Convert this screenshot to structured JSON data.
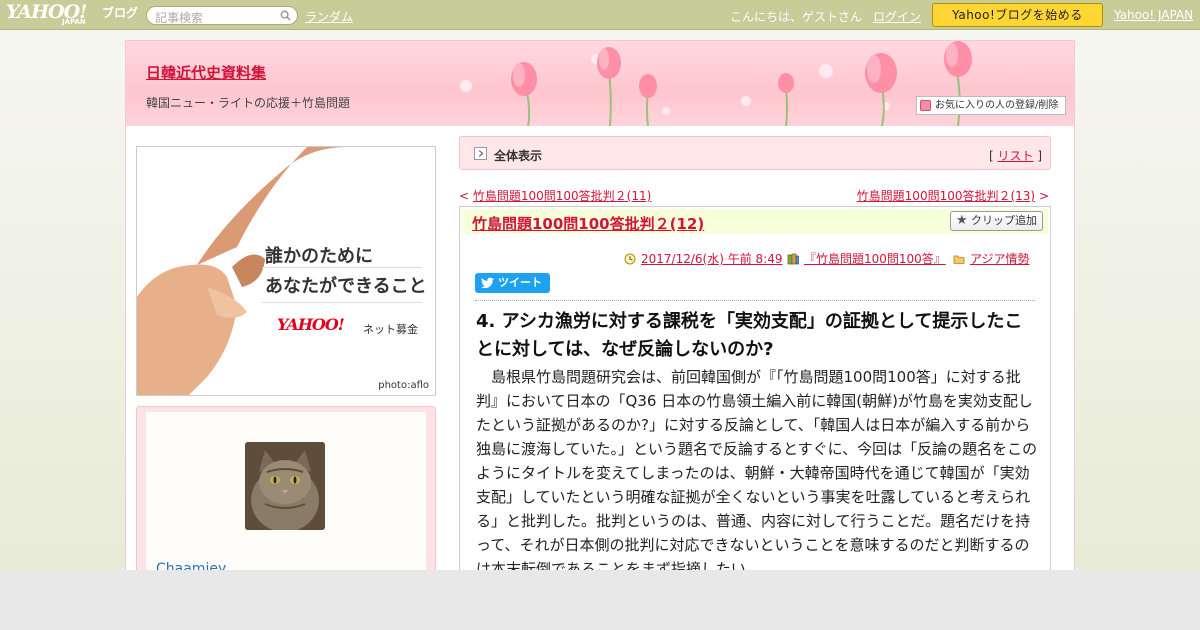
{
  "topbar": {
    "logo_text": "YAHOO!",
    "logo_sub": "JAPAN",
    "logo_blog": "ブログ",
    "search_placeholder": "記事検索",
    "random_label": "ランダム",
    "greeting": "こんにちは、ゲストさん",
    "login_label": "ログイン",
    "start_button": "Yahoo!ブログを始める",
    "yahoo_japan_link": "Yahoo! JAPAN"
  },
  "header": {
    "blog_title": "日韓近代史資料集",
    "blog_description": "韓国ニュー・ライトの応援＋竹島問題",
    "favorite_button": "お気に入りの人の登録/削除"
  },
  "sidebar": {
    "banner": {
      "line1": "誰かのために",
      "line2": "あなたができること",
      "brand": "YAHOO!",
      "brand_sub": "ネット募金",
      "credit": "photo:aflo"
    },
    "profile": {
      "name": "Chaamiey"
    }
  },
  "main": {
    "full_view_label": "全体表示",
    "list_bracket_open": "[ ",
    "list_link": "リスト",
    "list_bracket_close": " ]",
    "prev_arrow": "< ",
    "prev_link": "竹島問題100問100答批判２(11)",
    "next_link": "竹島問題100問100答批判２(13)",
    "next_arrow": " >",
    "article": {
      "title": "竹島問題100問100答批判２(12)",
      "clip_button": "クリップ追加",
      "date": "2017/12/6(水) 午前 8:49",
      "book": "『竹島問題100問100答』",
      "category": "アジア情勢",
      "tweet_label": "ツイート",
      "heading": "4. アシカ漁労に対する課税を「実効支配」の証拠として提示したことに対しては、なぜ反論しないのか?",
      "body": "島根県竹島問題研究会は、前回韓国側が『「竹島問題100問100答」に対する批判』において日本の「Q36 日本の竹島領土編入前に韓国(朝鮮)が竹島を実効支配したという証拠があるのか?」に対する反論として、「韓国人は日本が編入する前から独島に渡海していた。」という題名で反論するとすぐに、今回は「反論の題名をこのようにタイトルを変えてしまったのは、朝鮮・大韓帝国時代を通じて韓国が「実効支配」していたという明確な証拠が全くないという事実を吐露していると考えられる」と批判した。批判というのは、普通、内容に対して行うことだ。題名だけを持って、それが日本側の批判に対応できないということを意味するのだと判断するのは本末転倒であることをまず指摘したい。"
    }
  },
  "colors": {
    "topbar": "#c8cc99",
    "accent_red": "#d2143a",
    "header_pink": "#ffc6cf",
    "start_button": "#ffd633",
    "tweet_blue": "#1da1f2"
  }
}
